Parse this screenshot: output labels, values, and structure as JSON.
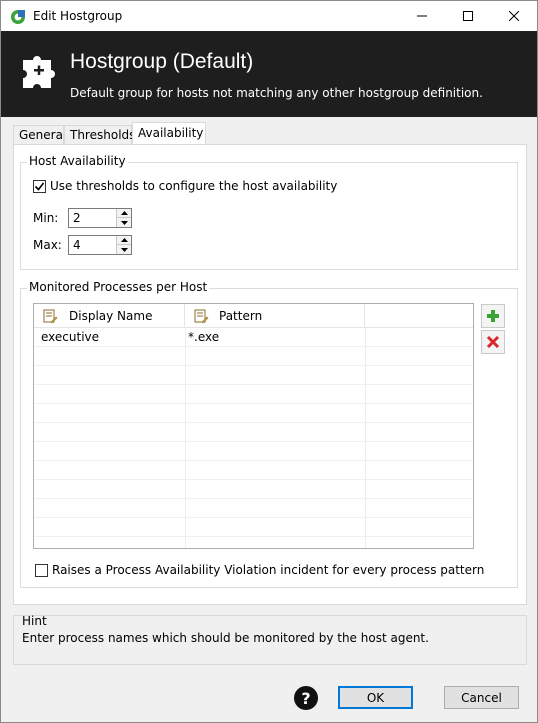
{
  "window": {
    "title": "Edit Hostgroup",
    "icon": "app-logo-icon"
  },
  "banner": {
    "title": "Hostgroup (Default)",
    "subtitle": "Default group for hosts not matching any other hostgroup definition."
  },
  "tabs": [
    {
      "label": "General",
      "active": false
    },
    {
      "label": "Thresholds",
      "active": false
    },
    {
      "label": "Availability",
      "active": true
    }
  ],
  "host_availability": {
    "group_label": "Host Availability",
    "use_thresholds_label": "Use thresholds to configure the host availability",
    "use_thresholds_checked": true,
    "min_label": "Min:",
    "min_value": "2",
    "max_label": "Max:",
    "max_value": "4"
  },
  "processes": {
    "group_label": "Monitored Processes per Host",
    "columns": [
      "Display Name",
      "Pattern"
    ],
    "rows": [
      {
        "display_name": "executive",
        "pattern": "*.exe"
      }
    ],
    "raise_violation_label": "Raises a Process Availability Violation incident for every process pattern",
    "raise_violation_checked": false
  },
  "hint": {
    "title": "Hint",
    "text": "Enter process names which should be monitored by the host agent."
  },
  "buttons": {
    "ok": "OK",
    "cancel": "Cancel",
    "help": "?"
  },
  "colors": {
    "banner_bg": "#1e1e1e",
    "accent": "#0078d7",
    "add_green": "#3aa335",
    "remove_red": "#d9262c"
  }
}
